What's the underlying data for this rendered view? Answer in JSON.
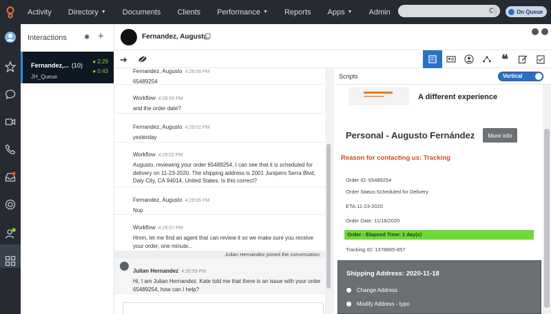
{
  "topnav": {
    "items": [
      {
        "label": "Activity",
        "dropdown": false
      },
      {
        "label": "Directory",
        "dropdown": true
      },
      {
        "label": "Documents",
        "dropdown": false
      },
      {
        "label": "Clients",
        "dropdown": false
      },
      {
        "label": "Performance",
        "dropdown": true
      },
      {
        "label": "Reports",
        "dropdown": false
      },
      {
        "label": "Apps",
        "dropdown": true
      },
      {
        "label": "Admin",
        "dropdown": false
      }
    ],
    "status_toggle": "On Queue"
  },
  "sidebar": {
    "title": "Interactions",
    "item": {
      "name": "Fernandez,...",
      "count": "(10)",
      "queue": "JH_Queue",
      "time1": "2:29",
      "time2": "0:43"
    }
  },
  "header": {
    "customer_name": "Fernandez, Augusto"
  },
  "chat": {
    "messages": [
      {
        "sender": "Fernandez, Augusto",
        "time": "4:28:56 PM",
        "text": "65489254"
      },
      {
        "sender": "Workflow",
        "time": "4:28:59 PM",
        "text": "and the order date?"
      },
      {
        "sender": "Fernandez, Augusto",
        "time": "4:29:02 PM",
        "text": "yesterday"
      },
      {
        "sender": "Workflow",
        "time": "4:29:02 PM",
        "text": "Augusto, reviewing your order 65489254, I can see that it is scheduled for delivery on 11-23-2020. The shipping address is 2001 Junipero Serra Blvd, Daly City, CA 94014, United States. Is this correct?"
      },
      {
        "sender": "Fernandez, Augusto",
        "time": "4:29:05 PM",
        "text": "Nop"
      },
      {
        "sender": "Workflow",
        "time": "4:29:07 PM",
        "text": "Hmm, let me find an agent that can review it so we make sure you receive your order, one minute..."
      },
      {
        "sender": "Julian Hernandez",
        "time": "4:30:59 PM",
        "text": "Hi, I am Julian Hernandez. Kate told me that there is an issue with your order 65489254, how can I help?"
      }
    ],
    "system_note": "Julian Hernandez joined the conversation"
  },
  "script": {
    "title": "Scripts",
    "layout_toggle": "Vertical",
    "tagline": "A different experience",
    "person": "Personal - Augusto Fernández",
    "more_info": "More info",
    "reason": "Reason for contacting us: Tracking",
    "fields": [
      "Order ID: 65489254",
      "Order Status:Scheduled for Delivery",
      "ETA:11-23-2020",
      "Order Date: 11/18/2020"
    ],
    "elapsed": "Order - Elapsed Time: 1 day(s)",
    "tracking": "Tracking ID: 1378865-857",
    "shipping_title": "Shipping Address: 2020-11-18",
    "options": [
      "Change Address",
      "Modify Address - typo"
    ]
  },
  "colors": {
    "topbar": "#262b33",
    "accent_blue": "#2b71c2",
    "reason_orange": "#d2491f",
    "elapsed_green": "#6fd93a",
    "timer_green": "#7fd23a"
  }
}
